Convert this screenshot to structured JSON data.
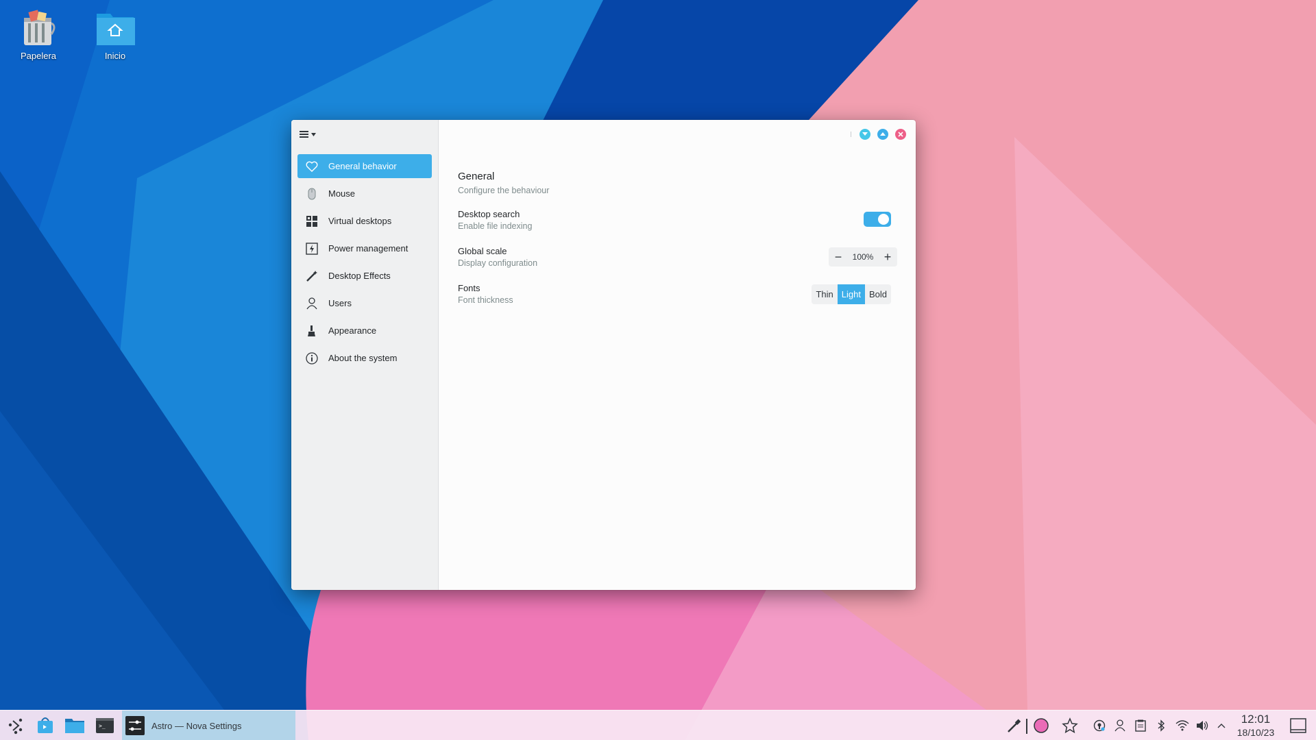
{
  "desktop": {
    "icons": [
      {
        "label": "Papelera",
        "icon": "trash-icon"
      },
      {
        "label": "Inicio",
        "icon": "home-folder-icon"
      }
    ]
  },
  "window": {
    "menu_icon": "hamburger-menu-icon",
    "controls": [
      "minimize",
      "maximize",
      "close"
    ],
    "sidebar": {
      "items": [
        {
          "label": "General behavior",
          "icon": "heart-icon",
          "active": true
        },
        {
          "label": "Mouse",
          "icon": "mouse-icon"
        },
        {
          "label": "Virtual desktops",
          "icon": "virtual-desktops-icon"
        },
        {
          "label": "Power management",
          "icon": "power-icon"
        },
        {
          "label": "Desktop Effects",
          "icon": "effects-wand-icon"
        },
        {
          "label": "Users",
          "icon": "user-icon"
        },
        {
          "label": "Appearance",
          "icon": "brush-icon"
        },
        {
          "label": "About the system",
          "icon": "info-icon"
        }
      ]
    },
    "main": {
      "title": "General",
      "subtitle": "Configure the behaviour",
      "desktop_search": {
        "title": "Desktop search",
        "subtitle": "Enable file indexing",
        "enabled": true
      },
      "global_scale": {
        "title": "Global scale",
        "subtitle": "Display configuration",
        "value": "100%",
        "minus": "−",
        "plus": "+"
      },
      "fonts": {
        "title": "Fonts",
        "subtitle": "Font thickness",
        "options": [
          "Thin",
          "Light",
          "Bold"
        ],
        "selected": "Light"
      }
    }
  },
  "taskbar": {
    "active_task": "Astro — Nova Settings",
    "clock": {
      "time": "12:01",
      "date": "18/10/23"
    }
  },
  "colors": {
    "accent": "#3daee9",
    "close": "#ed5f88",
    "min": "#46c7e8",
    "max": "#3daee9"
  }
}
